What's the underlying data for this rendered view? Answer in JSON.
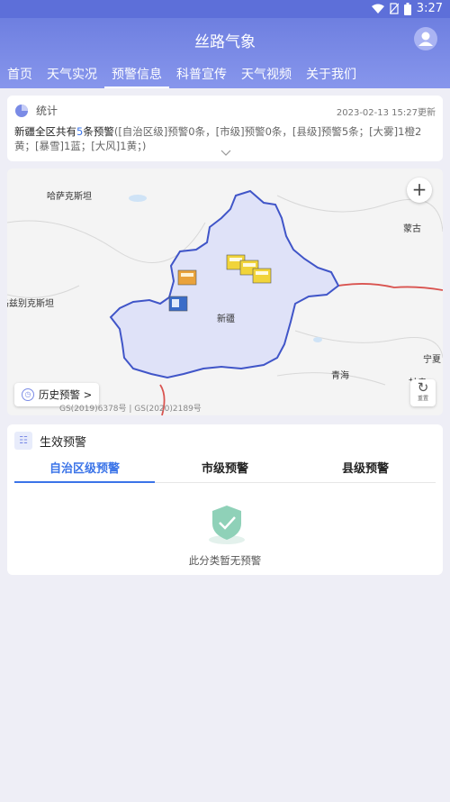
{
  "status_bar": {
    "time": "3:27",
    "wifi_icon": "wifi-icon",
    "sim_icon": "no-sim-icon",
    "battery_icon": "battery-icon"
  },
  "app": {
    "title": "丝路气象",
    "profile_icon": "user-avatar-icon"
  },
  "nav_tabs": [
    {
      "label": "首页"
    },
    {
      "label": "天气实况"
    },
    {
      "label": "预警信息",
      "active": true
    },
    {
      "label": "科普宣传"
    },
    {
      "label": "天气视频"
    },
    {
      "label": "关于我们"
    }
  ],
  "stats": {
    "icon": "pie-chart-icon",
    "label": "统计",
    "updated": "2023-02-13 15:27更新",
    "summary_prefix": "新疆全区共有",
    "total": "5",
    "summary_suffix": "条预警",
    "detail": "([自治区级]预警0条，[市级]预警0条，[县级]预警5条；[大雾]1橙2黄；[暴雪]1蓝；[大风]1黄；)",
    "expand_icon": "chevron-down-icon"
  },
  "map": {
    "labels": {
      "kazakhstan": "哈萨克斯坦",
      "mongolia": "蒙古",
      "uzbekistan": "乌兹别克斯坦",
      "xinjiang": "新疆",
      "qinghai": "青海",
      "ningxia": "宁夏",
      "gansu": "甘肃"
    },
    "zoom_icon": "plus-icon",
    "reset_label": "重置",
    "reset_icon": "refresh-icon",
    "history_label": "历史预警 >",
    "history_icon": "clock-icon",
    "copyright": "GS(2019)6378号 | GS(2020)2189号",
    "colors": {
      "region_fill": "#dfe2f8",
      "region_border": "#4055c8",
      "border_red": "#d9534f",
      "warning_orange": "#e9a23b",
      "warning_yellow": "#f1d43a",
      "warning_blue": "#3a6cc8"
    }
  },
  "warnings": {
    "icon": "warning-doc-icon",
    "title": "生效预警",
    "tabs": [
      {
        "label": "自治区级预警",
        "active": true
      },
      {
        "label": "市级预警"
      },
      {
        "label": "县级预警"
      }
    ],
    "empty_icon": "shield-check-icon",
    "empty_text": "此分类暂无预警"
  }
}
